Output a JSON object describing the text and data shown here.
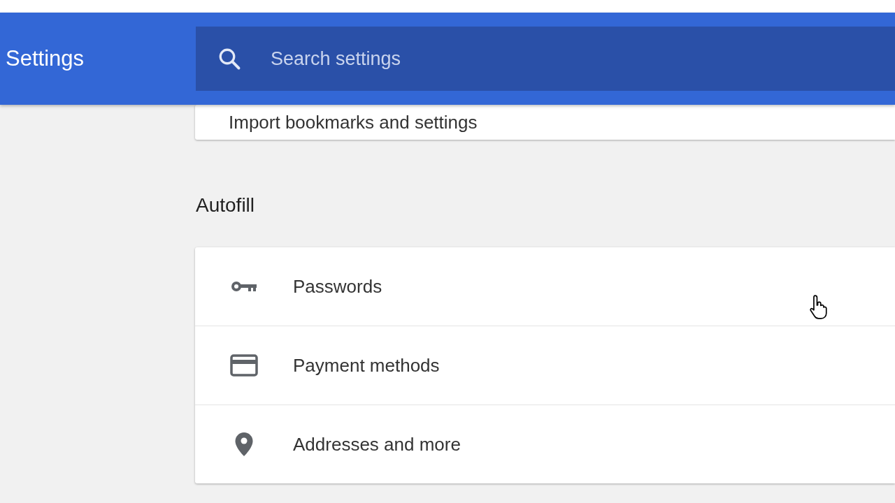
{
  "header": {
    "title": "Settings",
    "search": {
      "placeholder": "Search settings"
    }
  },
  "top_card": {
    "label": "Import bookmarks and settings"
  },
  "autofill": {
    "heading": "Autofill",
    "items": [
      {
        "kind": "key",
        "label": "Passwords"
      },
      {
        "kind": "card",
        "label": "Payment methods"
      },
      {
        "kind": "pin",
        "label": "Addresses and more"
      }
    ]
  }
}
